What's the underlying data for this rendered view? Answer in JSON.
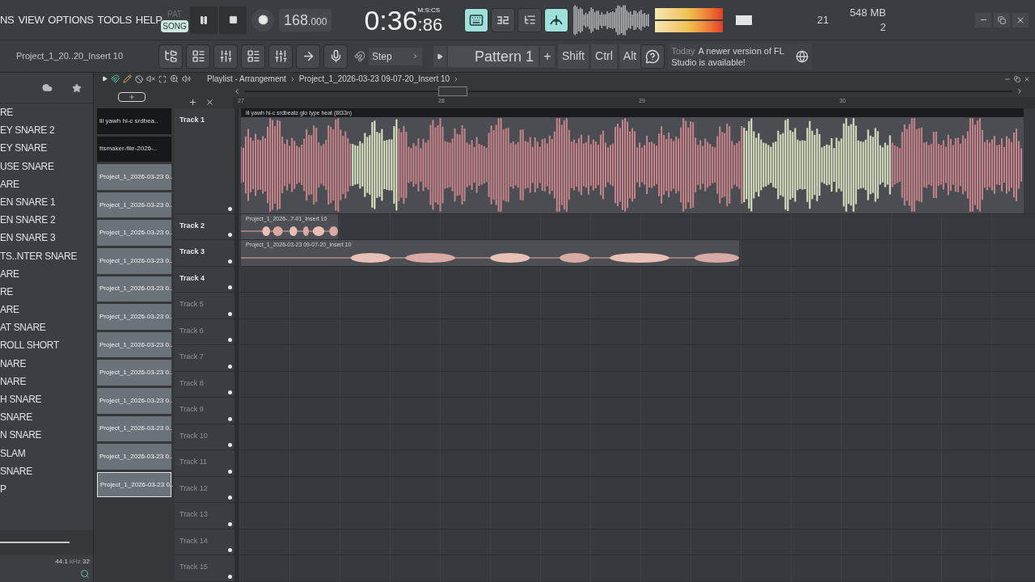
{
  "menu": [
    "NS",
    "VIEW",
    "OPTIONS",
    "TOOLS",
    "HELP"
  ],
  "project_hint": "Project_1_20..20_Insert 10",
  "transport": {
    "modes": [
      {
        "label": "PAT",
        "selected": false
      },
      {
        "label": "SONG",
        "selected": true
      }
    ],
    "playing": true,
    "tempo": "168",
    "tempo_fraction": ".000"
  },
  "clock": {
    "time": "0:36",
    "centis": ":86",
    "format": "M:S:CS"
  },
  "stats": {
    "cpu": "21",
    "memory": "548 MB",
    "polyphony": "2"
  },
  "toolbar": {
    "snap": "Step",
    "pattern": "Pattern 1",
    "add": "+",
    "keys": [
      "Shift",
      "Ctrl",
      "Alt"
    ]
  },
  "hint": {
    "day": "Today",
    "message": "A newer version of FL Studio is available!"
  },
  "browser": {
    "items": [
      "RE",
      "EY SNARE 2",
      "EY SNARE",
      "USE SNARE",
      "ARE",
      "EN SNARE 1",
      "EN SNARE 2",
      "EN SNARE 3",
      "TS..NTER SNARE",
      "ARE",
      "RE",
      "ARE",
      "AT SNARE",
      "ROLL SHORT",
      "NARE",
      "NARE",
      "H SNARE",
      "SNARE",
      "N SNARE",
      "SLAM",
      "SNARE",
      "P"
    ],
    "rate": "44.1",
    "rate_unit": "kHz",
    "bits": "32"
  },
  "playlist": {
    "title": "Playlist - Arrangement",
    "breadcrumb": "Project_1_2026-03-23 09-07-20_Insert 10",
    "picker": [
      {
        "name": "lil yawh  hi-c  srdbea..",
        "kind": "dark",
        "selected": false
      },
      {
        "name": "ttsmaker-file-2026-..",
        "kind": "dark",
        "selected": false
      },
      {
        "name": "Project_1_2026-03-23 0..",
        "kind": "light",
        "selected": false
      },
      {
        "name": "Project_1_2026-03-23 0..",
        "kind": "light",
        "selected": false
      },
      {
        "name": "Project_1_2026-03-23 0..",
        "kind": "light",
        "selected": false
      },
      {
        "name": "Project_1_2026-03-23 0..",
        "kind": "light",
        "selected": false
      },
      {
        "name": "Project_1_2026-03-23 0..",
        "kind": "light",
        "selected": false
      },
      {
        "name": "Project_1_2026-03-23 0..",
        "kind": "light",
        "selected": false
      },
      {
        "name": "Project_1_2026-03-23 0..",
        "kind": "light",
        "selected": false
      },
      {
        "name": "Project_1_2026-03-23 0..",
        "kind": "light",
        "selected": false
      },
      {
        "name": "Project_1_2026-03-23 0..",
        "kind": "light",
        "selected": false
      },
      {
        "name": "Project_1_2026-03-23 0..",
        "kind": "light",
        "selected": false
      },
      {
        "name": "Project_1_2026-03-23 0..",
        "kind": "light",
        "selected": false
      },
      {
        "name": "Project_1_2026-03-23 0..",
        "kind": "light",
        "selected": true
      }
    ],
    "ruler": [
      "27",
      "28",
      "29",
      "30"
    ],
    "tracks": [
      {
        "name": "Track 1",
        "dimmed": false,
        "clip": "lil yawh  hi-c  srdbeatz glo type beat (8t33n)"
      },
      {
        "name": "Track 2",
        "dimmed": false,
        "clip": "Project_1_2026-..7-01_Insert 10"
      },
      {
        "name": "Track 3",
        "dimmed": false,
        "clip": "Project_1_2026-03-23 09-07-20_Insert 10"
      },
      {
        "name": "Track 4",
        "dimmed": false
      },
      {
        "name": "Track 5",
        "dimmed": true
      },
      {
        "name": "Track 6",
        "dimmed": true
      },
      {
        "name": "Track 7",
        "dimmed": true
      },
      {
        "name": "Track 8",
        "dimmed": true
      },
      {
        "name": "Track 9",
        "dimmed": true
      },
      {
        "name": "Track 10",
        "dimmed": true
      },
      {
        "name": "Track 11",
        "dimmed": true
      },
      {
        "name": "Track 12",
        "dimmed": true
      },
      {
        "name": "Track 13",
        "dimmed": true
      },
      {
        "name": "Track 14",
        "dimmed": true
      },
      {
        "name": "Track 15",
        "dimmed": true
      }
    ]
  }
}
